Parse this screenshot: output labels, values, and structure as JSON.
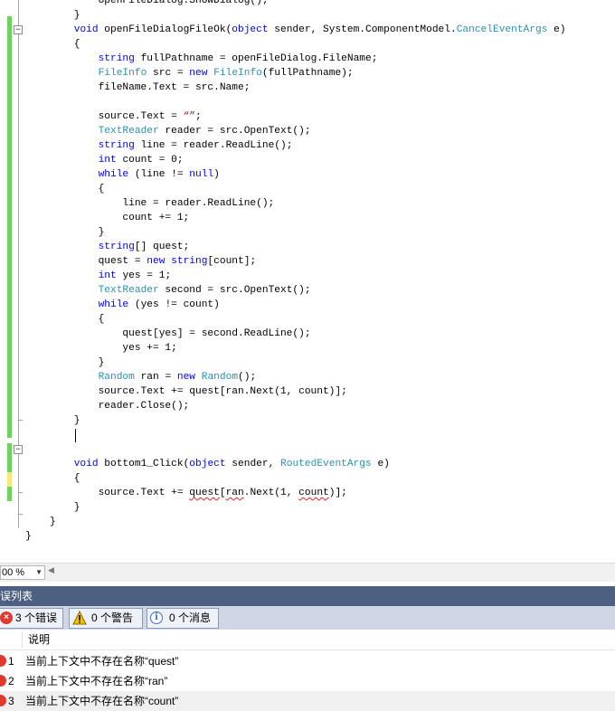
{
  "code_lines": [
    [
      {
        "t": "            openFileDialog.ShowDialog();",
        "c": ""
      }
    ],
    [
      {
        "t": "        }",
        "c": ""
      }
    ],
    [
      {
        "t": "        ",
        "c": ""
      },
      {
        "t": "void",
        "c": "kw"
      },
      {
        "t": " openFileDialogFileOk(",
        "c": ""
      },
      {
        "t": "object",
        "c": "kw"
      },
      {
        "t": " sender, System.ComponentModel.",
        "c": ""
      },
      {
        "t": "CancelEventArgs",
        "c": "ty"
      },
      {
        "t": " e)",
        "c": ""
      }
    ],
    [
      {
        "t": "        {",
        "c": ""
      }
    ],
    [
      {
        "t": "            ",
        "c": ""
      },
      {
        "t": "string",
        "c": "kw"
      },
      {
        "t": " fullPathname = openFileDialog.FileName;",
        "c": ""
      }
    ],
    [
      {
        "t": "            ",
        "c": ""
      },
      {
        "t": "FileInfo",
        "c": "ty"
      },
      {
        "t": " src = ",
        "c": ""
      },
      {
        "t": "new",
        "c": "kw"
      },
      {
        "t": " ",
        "c": ""
      },
      {
        "t": "FileInfo",
        "c": "ty"
      },
      {
        "t": "(fullPathname);",
        "c": ""
      }
    ],
    [
      {
        "t": "            fileName.Text = src.Name;",
        "c": ""
      }
    ],
    [
      {
        "t": "",
        "c": ""
      }
    ],
    [
      {
        "t": "            source.Text = ",
        "c": ""
      },
      {
        "t": "“”",
        "c": "st"
      },
      {
        "t": ";",
        "c": ""
      }
    ],
    [
      {
        "t": "            ",
        "c": ""
      },
      {
        "t": "TextReader",
        "c": "ty"
      },
      {
        "t": " reader = src.OpenText();",
        "c": ""
      }
    ],
    [
      {
        "t": "            ",
        "c": ""
      },
      {
        "t": "string",
        "c": "kw"
      },
      {
        "t": " line = reader.ReadLine();",
        "c": ""
      }
    ],
    [
      {
        "t": "            ",
        "c": ""
      },
      {
        "t": "int",
        "c": "kw"
      },
      {
        "t": " count = 0;",
        "c": ""
      }
    ],
    [
      {
        "t": "            ",
        "c": ""
      },
      {
        "t": "while",
        "c": "kw"
      },
      {
        "t": " (line != ",
        "c": ""
      },
      {
        "t": "null",
        "c": "kw"
      },
      {
        "t": ")",
        "c": ""
      }
    ],
    [
      {
        "t": "            {",
        "c": ""
      }
    ],
    [
      {
        "t": "                line = reader.ReadLine();",
        "c": ""
      }
    ],
    [
      {
        "t": "                count += 1;",
        "c": ""
      }
    ],
    [
      {
        "t": "            }",
        "c": ""
      }
    ],
    [
      {
        "t": "            ",
        "c": ""
      },
      {
        "t": "string",
        "c": "kw"
      },
      {
        "t": "[] quest;",
        "c": ""
      }
    ],
    [
      {
        "t": "            quest = ",
        "c": ""
      },
      {
        "t": "new",
        "c": "kw"
      },
      {
        "t": " ",
        "c": ""
      },
      {
        "t": "string",
        "c": "kw"
      },
      {
        "t": "[count];",
        "c": ""
      }
    ],
    [
      {
        "t": "            ",
        "c": ""
      },
      {
        "t": "int",
        "c": "kw"
      },
      {
        "t": " yes = 1;",
        "c": ""
      }
    ],
    [
      {
        "t": "            ",
        "c": ""
      },
      {
        "t": "TextReader",
        "c": "ty"
      },
      {
        "t": " second = src.OpenText();",
        "c": ""
      }
    ],
    [
      {
        "t": "            ",
        "c": ""
      },
      {
        "t": "while",
        "c": "kw"
      },
      {
        "t": " (yes != count)",
        "c": ""
      }
    ],
    [
      {
        "t": "            {",
        "c": ""
      }
    ],
    [
      {
        "t": "                quest[yes] = second.ReadLine();",
        "c": ""
      }
    ],
    [
      {
        "t": "                yes += 1;",
        "c": ""
      }
    ],
    [
      {
        "t": "            }",
        "c": ""
      }
    ],
    [
      {
        "t": "            ",
        "c": ""
      },
      {
        "t": "Random",
        "c": "ty"
      },
      {
        "t": " ran = ",
        "c": ""
      },
      {
        "t": "new",
        "c": "kw"
      },
      {
        "t": " ",
        "c": ""
      },
      {
        "t": "Random",
        "c": "ty"
      },
      {
        "t": "();",
        "c": ""
      }
    ],
    [
      {
        "t": "            source.Text += quest[ran.Next(1, count)];",
        "c": ""
      }
    ],
    [
      {
        "t": "            reader.Close();",
        "c": ""
      }
    ],
    [
      {
        "t": "        }",
        "c": ""
      }
    ],
    [
      {
        "t": "",
        "c": ""
      }
    ],
    [
      {
        "t": "",
        "c": ""
      }
    ],
    [
      {
        "t": "        ",
        "c": ""
      },
      {
        "t": "void",
        "c": "kw"
      },
      {
        "t": " bottom1_Click(",
        "c": ""
      },
      {
        "t": "object",
        "c": "kw"
      },
      {
        "t": " sender, ",
        "c": ""
      },
      {
        "t": "RoutedEventArgs",
        "c": "ty"
      },
      {
        "t": " e)",
        "c": ""
      }
    ],
    [
      {
        "t": "        {",
        "c": ""
      }
    ],
    [
      {
        "t": "            source.Text += ",
        "c": ""
      },
      {
        "t": "quest",
        "c": "sq"
      },
      {
        "t": "[",
        "c": ""
      },
      {
        "t": "ran",
        "c": "sq"
      },
      {
        "t": ".Next(1, ",
        "c": ""
      },
      {
        "t": "count",
        "c": "sq"
      },
      {
        "t": ")];",
        "c": ""
      }
    ],
    [
      {
        "t": "        }",
        "c": ""
      }
    ],
    [
      {
        "t": "    }",
        "c": ""
      }
    ],
    [
      {
        "t": "}",
        "c": ""
      }
    ]
  ],
  "colors": {
    "keyword": "#0000ff",
    "type": "#2b91af",
    "string": "#a31515",
    "panel_title_bg": "#4d6082",
    "error_icon": "#e03a2e"
  },
  "status": {
    "zoom_value": "00 %"
  },
  "error_list": {
    "title": "错误列表",
    "filters": {
      "errors": "3 个错误",
      "warnings": "0 个警告",
      "messages": "0 个消息"
    },
    "column_description": "说明",
    "rows": [
      {
        "num": "1",
        "desc": "当前上下文中不存在名称“quest”"
      },
      {
        "num": "2",
        "desc": "当前上下文中不存在名称“ran”"
      },
      {
        "num": "3",
        "desc": "当前上下文中不存在名称“count”"
      }
    ]
  },
  "icons": {
    "error": "error-icon",
    "warning": "warning-icon",
    "info": "info-icon",
    "zoom_dropdown": "chevron-down-icon",
    "scroll_left": "scroll-left-arrow-icon"
  }
}
